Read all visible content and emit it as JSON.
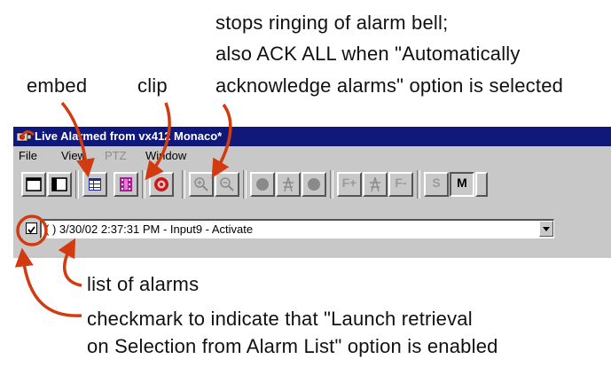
{
  "annotations": {
    "stops_line1": "stops ringing of alarm bell;",
    "stops_line2": "also ACK ALL when \"Automatically",
    "stops_line3": "acknowledge alarms\" option is selected",
    "embed": "embed",
    "clip": "clip",
    "list": "list of alarms",
    "check_line1": "checkmark to indicate that \"Launch retrieval",
    "check_line2": "on Selection from Alarm List\" option is enabled"
  },
  "window": {
    "title": "Live Alarmed from vx412 Monaco*",
    "menu": [
      "File",
      "View",
      "PTZ",
      "Window"
    ]
  },
  "toolbar": {
    "buttons": [
      "single-view",
      "dual-view",
      "embed",
      "clip",
      "alarm-bell",
      "zoom-in",
      "zoom-out",
      "record",
      "ptz-center",
      "stop",
      "focus-plus",
      "focus-center",
      "focus-minus",
      "S",
      "M"
    ]
  },
  "alarm_list": {
    "checked": true,
    "selected_text": "( ) 3/30/02 2:37:31 PM - Input9 - Activate"
  },
  "colors": {
    "arrow": "#d23a10",
    "titlebar": "#10187a",
    "window_bg": "#c8c8c8"
  }
}
